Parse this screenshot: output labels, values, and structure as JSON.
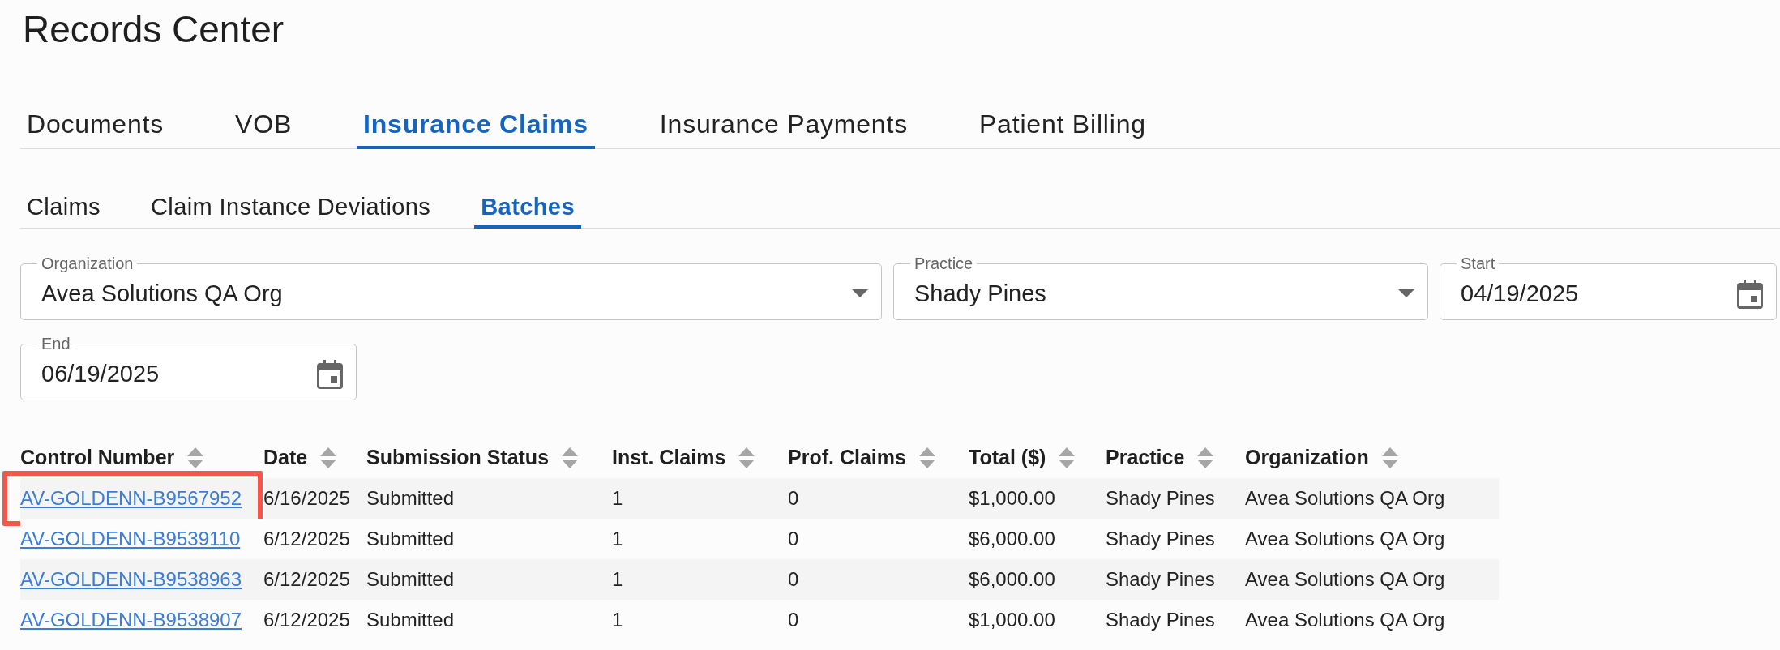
{
  "page_title": "Records Center",
  "tabs": [
    {
      "label": "Documents",
      "selected": false
    },
    {
      "label": "VOB",
      "selected": false
    },
    {
      "label": "Insurance Claims",
      "selected": true
    },
    {
      "label": "Insurance Payments",
      "selected": false
    },
    {
      "label": "Patient Billing",
      "selected": false
    }
  ],
  "subtabs": [
    {
      "label": "Claims",
      "selected": false
    },
    {
      "label": "Claim Instance Deviations",
      "selected": false
    },
    {
      "label": "Batches",
      "selected": true
    }
  ],
  "filters": [
    {
      "kind": "select",
      "label": "Organization",
      "value": "Avea Solutions QA Org"
    },
    {
      "kind": "select",
      "label": "Practice",
      "value": "Shady Pines"
    },
    {
      "kind": "date",
      "label": "Start",
      "value": "04/19/2025"
    },
    {
      "kind": "date",
      "label": "End",
      "value": "06/19/2025"
    }
  ],
  "table": {
    "columns": [
      "Control Number",
      "Date",
      "Submission Status",
      "Inst. Claims",
      "Prof. Claims",
      "Total ($)",
      "Practice",
      "Organization"
    ],
    "rows": [
      {
        "highlighted": true,
        "cells": [
          "AV-GOLDENN-B9567952",
          "6/16/2025",
          "Submitted",
          "1",
          "0",
          "$1,000.00",
          "Shady Pines",
          "Avea Solutions QA Org"
        ]
      },
      {
        "highlighted": false,
        "cells": [
          "AV-GOLDENN-B9539110",
          "6/12/2025",
          "Submitted",
          "1",
          "0",
          "$6,000.00",
          "Shady Pines",
          "Avea Solutions QA Org"
        ]
      },
      {
        "highlighted": false,
        "cells": [
          "AV-GOLDENN-B9538963",
          "6/12/2025",
          "Submitted",
          "1",
          "0",
          "$6,000.00",
          "Shady Pines",
          "Avea Solutions QA Org"
        ]
      },
      {
        "highlighted": false,
        "cells": [
          "AV-GOLDENN-B9538907",
          "6/12/2025",
          "Submitted",
          "1",
          "0",
          "$1,000.00",
          "Shady Pines",
          "Avea Solutions QA Org"
        ]
      }
    ]
  }
}
